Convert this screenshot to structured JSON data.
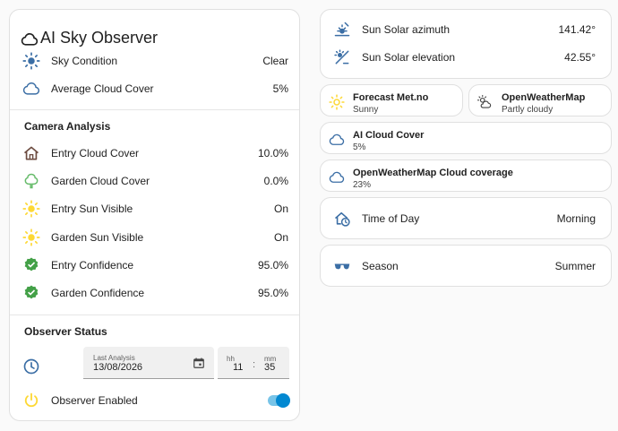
{
  "left_card": {
    "title": "AI Sky Observer",
    "title_icon": "cloud-outline-icon",
    "summary": [
      {
        "icon": "sun-icon",
        "label": "Sky Condition",
        "value": "Clear"
      },
      {
        "icon": "cloud-icon",
        "label": "Average Cloud Cover",
        "value": "5%"
      }
    ],
    "camera": {
      "title": "Camera Analysis",
      "rows": [
        {
          "icon": "home-icon",
          "label": "Entry Cloud Cover",
          "value": "10.0%"
        },
        {
          "icon": "tree-icon",
          "label": "Garden Cloud Cover",
          "value": "0.0%"
        },
        {
          "icon": "sun-icon",
          "label": "Entry Sun Visible",
          "value": "On"
        },
        {
          "icon": "sun-icon",
          "label": "Garden Sun Visible",
          "value": "On"
        },
        {
          "icon": "check-badge-icon",
          "label": "Entry Confidence",
          "value": "95.0%"
        },
        {
          "icon": "check-badge-icon",
          "label": "Garden Confidence",
          "value": "95.0%"
        }
      ]
    },
    "status": {
      "title": "Observer Status",
      "last_analysis_label": "Last Analysis",
      "last_analysis_date": "13/08/2026",
      "hour_label": "hh",
      "minute_label": "mm",
      "hour": "11",
      "minute": "35",
      "colon": ":",
      "enabled_label": "Observer Enabled",
      "enabled": true
    }
  },
  "right": {
    "sun": [
      {
        "icon": "sun-azimuth-icon",
        "label": "Sun Solar azimuth",
        "value": "141.42°"
      },
      {
        "icon": "sun-elevation-icon",
        "label": "Sun Solar elevation",
        "value": "42.55°"
      }
    ],
    "forecast_met": {
      "icon": "sun-icon",
      "name": "Forecast Met.no",
      "state": "Sunny"
    },
    "openweathermap": {
      "icon": "partly-cloudy-icon",
      "name": "OpenWeatherMap",
      "state": "Partly cloudy"
    },
    "ai_cloud": {
      "icon": "cloud-icon",
      "name": "AI Cloud Cover",
      "state": "5%"
    },
    "owm_cloud": {
      "icon": "cloud-icon",
      "name": "OpenWeatherMap Cloud coverage",
      "state": "23%"
    },
    "time_of_day": {
      "icon": "home-clock-icon",
      "label": "Time of Day",
      "value": "Morning"
    },
    "season": {
      "icon": "sunglasses-icon",
      "label": "Season",
      "value": "Summer"
    }
  },
  "colors": {
    "accent_blue": "#3b6ea5",
    "sun_yellow": "#fdd835",
    "check_green": "#43a047",
    "home_brown": "#6d4c41",
    "tree_green": "#66bb6a",
    "toggle_blue": "#0288d1"
  }
}
